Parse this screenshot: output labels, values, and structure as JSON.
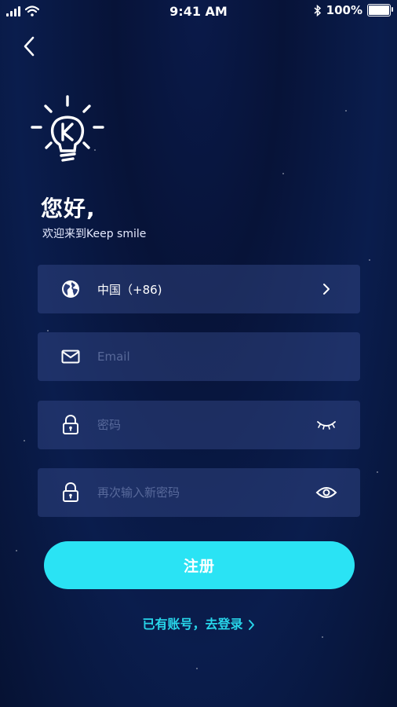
{
  "status_bar": {
    "time": "9:41 AM",
    "battery": "100%",
    "battery_level": 1.0,
    "icons": [
      "signal-icon",
      "wifi-icon",
      "bluetooth-icon",
      "battery-icon"
    ]
  },
  "header": {
    "back_icon": "chevron-left-icon"
  },
  "logo": {
    "icon": "lightbulb-k-logo"
  },
  "greeting": {
    "title": "您好,",
    "subtitle": "欢迎来到Keep smile"
  },
  "form": {
    "country": {
      "label": "中国（+86)",
      "icon": "globe-icon",
      "trail_icon": "chevron-right-icon"
    },
    "email": {
      "placeholder": "Email",
      "value": "",
      "icon": "mail-icon"
    },
    "password": {
      "placeholder": "密码",
      "value": "",
      "icon": "lock-icon",
      "trail_icon": "eye-closed-icon"
    },
    "password_confirm": {
      "placeholder": "再次输入新密码",
      "value": "",
      "icon": "lock-icon",
      "trail_icon": "eye-open-icon"
    }
  },
  "actions": {
    "register_label": "注册",
    "login_link": "已有账号，去登录"
  },
  "colors": {
    "background": "#071338",
    "field_bg": "#2a3d78",
    "accent": "#2ae3f4",
    "link": "#28d6ea"
  }
}
